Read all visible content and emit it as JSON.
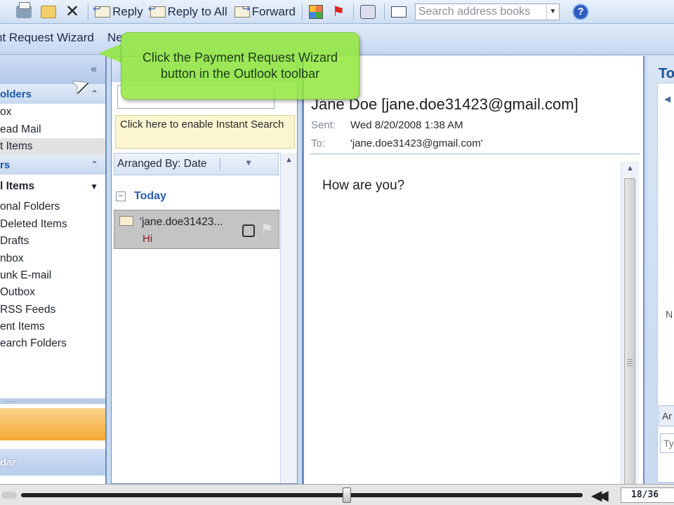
{
  "toolbar": {
    "reply_label": "Reply",
    "reply_all_label": "Reply to All",
    "forward_label": "Forward",
    "search_placeholder": "Search address books",
    "help_glyph": "?"
  },
  "toolbar2": {
    "wizard_label": "nt Request Wizard",
    "new_label": "Ne"
  },
  "callout": {
    "text": "Click the Payment Request Wizard button in the Outlook toolbar"
  },
  "nav": {
    "collapse_glyph": "«",
    "favorites_header": "olders",
    "favorites": [
      "ox",
      "ead Mail",
      "t Items"
    ],
    "mail_header": "rs",
    "all_items": "l Items",
    "folders": [
      "onal Folders",
      "Deleted Items",
      "Drafts",
      "nbox",
      "unk E-mail",
      "Outbox",
      "RSS Feeds",
      "ent Items",
      "earch Folders"
    ],
    "grip": "·····",
    "calendar_label": "dar"
  },
  "list": {
    "instant_search": "Click here to enable Instant Search",
    "arranged_by": "Arranged By: Date",
    "group_label": "Today",
    "group_toggle": "−",
    "message": {
      "from": "'jane.doe31423...",
      "subject": "Hi"
    }
  },
  "reading": {
    "sender": "Jane Doe [jane.doe31423@gmail.com]",
    "sent_label": "Sent:",
    "sent_value": "Wed 8/20/2008 1:38 AM",
    "to_label": "To:",
    "to_value": "'jane.doe31423@gmail.com'",
    "body": "How are you?"
  },
  "todo": {
    "title": "To",
    "n_label": "N",
    "arrange_label": "Ar",
    "type_label": "Ty"
  },
  "player": {
    "position": 0.58,
    "counter": "18/36"
  },
  "colors": {
    "callout_bg": "#92e83c",
    "nav_header_text": "#1b5aa8",
    "mail_button": "#f6a933",
    "message_subject": "#8a1a1a"
  }
}
